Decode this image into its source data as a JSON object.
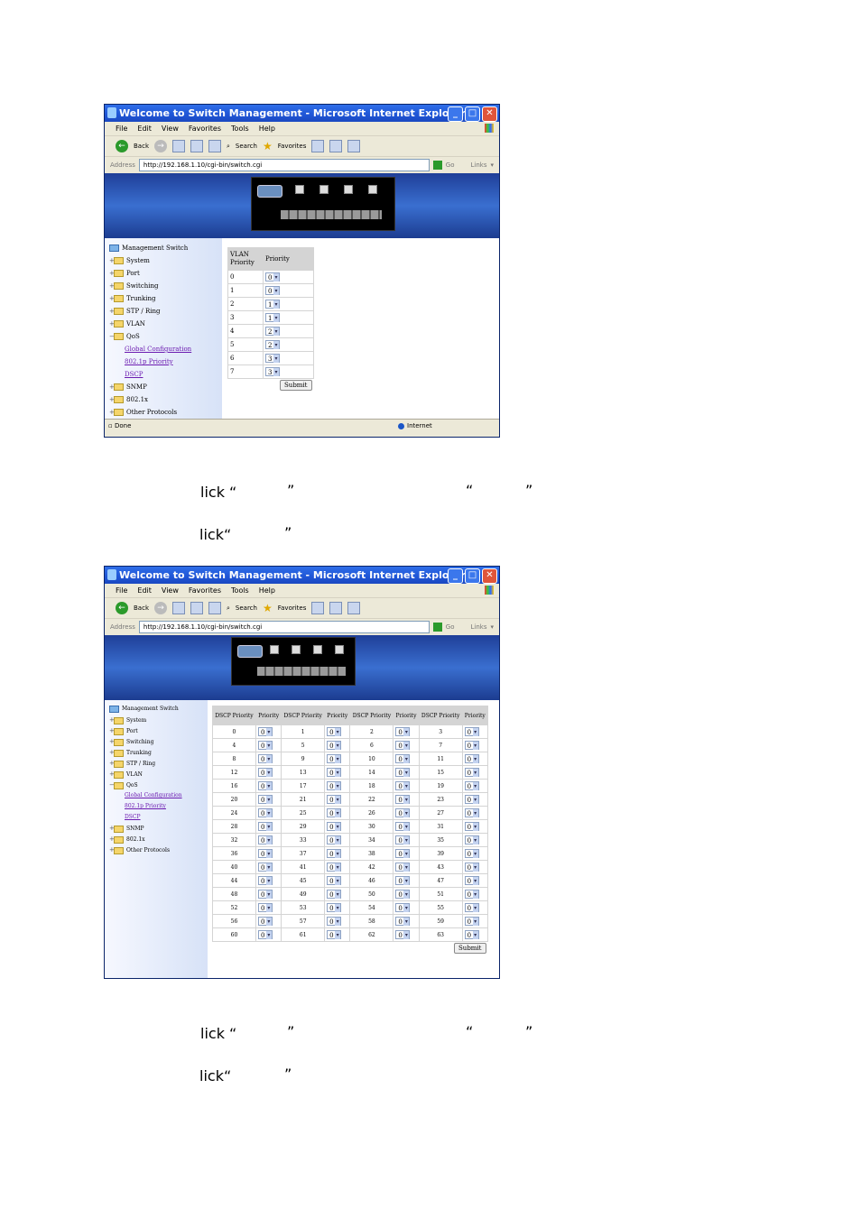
{
  "window": {
    "title": "Welcome to Switch Management - Microsoft Internet Explorer",
    "menu": [
      "File",
      "Edit",
      "View",
      "Favorites",
      "Tools",
      "Help"
    ],
    "toolbar": {
      "back": "Back",
      "search": "Search",
      "favorites": "Favorites"
    },
    "address_label": "Address",
    "address": "http://192.168.1.10/cgi-bin/switch.cgi",
    "go": "Go",
    "links": "Links",
    "status_left": "Done",
    "status_right": "Internet"
  },
  "tree": {
    "root": "Management Switch",
    "items": [
      "System",
      "Port",
      "Switching",
      "Trunking",
      "STP / Ring",
      "VLAN",
      "QoS"
    ],
    "qos_sub": [
      "Global Configuration",
      "802.1p Priority",
      "DSCP"
    ],
    "after": [
      "SNMP",
      "802.1x",
      "Other Protocols"
    ]
  },
  "vlan_table": {
    "headers": [
      "VLAN Priority",
      "Priority"
    ],
    "rows": [
      {
        "vlan": "0",
        "priority": "0"
      },
      {
        "vlan": "1",
        "priority": "0"
      },
      {
        "vlan": "2",
        "priority": "1"
      },
      {
        "vlan": "3",
        "priority": "1"
      },
      {
        "vlan": "4",
        "priority": "2"
      },
      {
        "vlan": "5",
        "priority": "2"
      },
      {
        "vlan": "6",
        "priority": "3"
      },
      {
        "vlan": "7",
        "priority": "3"
      }
    ],
    "submit": "Submit"
  },
  "dscp_table": {
    "headers": [
      "DSCP Priority",
      "Priority"
    ],
    "rows": [
      [
        "0",
        "1",
        "2",
        "3"
      ],
      [
        "4",
        "5",
        "6",
        "7"
      ],
      [
        "8",
        "9",
        "10",
        "11"
      ],
      [
        "12",
        "13",
        "14",
        "15"
      ],
      [
        "16",
        "17",
        "18",
        "19"
      ],
      [
        "20",
        "21",
        "22",
        "23"
      ],
      [
        "24",
        "25",
        "26",
        "27"
      ],
      [
        "28",
        "29",
        "30",
        "31"
      ],
      [
        "32",
        "33",
        "34",
        "35"
      ],
      [
        "36",
        "37",
        "38",
        "39"
      ],
      [
        "40",
        "41",
        "42",
        "43"
      ],
      [
        "44",
        "45",
        "46",
        "47"
      ],
      [
        "48",
        "49",
        "50",
        "51"
      ],
      [
        "52",
        "53",
        "54",
        "55"
      ],
      [
        "56",
        "57",
        "58",
        "59"
      ],
      [
        "60",
        "61",
        "62",
        "63"
      ]
    ],
    "priority_value": "0",
    "submit": "Submit"
  },
  "captions": {
    "c1a": "lick “",
    "c1b": "”",
    "c1c": "“",
    "c1d": "”",
    "c2a": "lick“",
    "c2b": "”",
    "c3a": "lick “",
    "c3b": "”",
    "c3c": "“",
    "c3d": "”",
    "c4a": "lick“",
    "c4b": "”"
  }
}
